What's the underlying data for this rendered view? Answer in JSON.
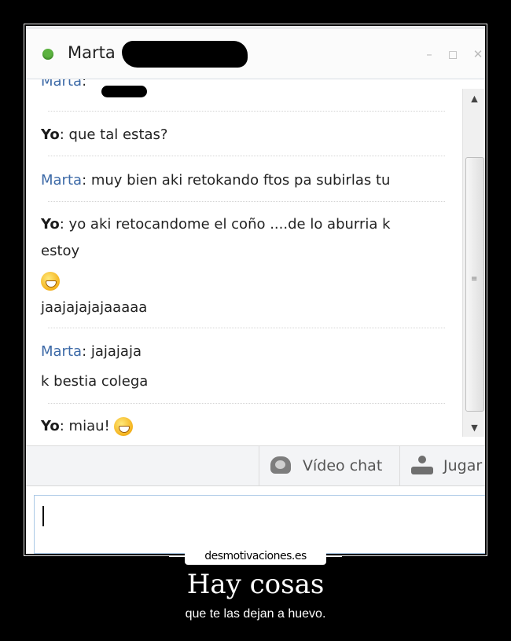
{
  "window": {
    "contact_name": "Marta",
    "controls": {
      "minimize": "–",
      "maximize": "◻",
      "close": "✕"
    }
  },
  "messages": [
    {
      "sender": "Marta",
      "sep": ": ",
      "text": ""
    },
    {
      "sender": "Yo",
      "sep": ": ",
      "text": "que tal estas?"
    },
    {
      "sender": "Marta",
      "sep": ": ",
      "text": "muy bien aki retokando ftos pa subirlas tu"
    },
    {
      "sender": "Yo",
      "sep": ": ",
      "text": "yo aki retocandome el coño ....de lo aburria k",
      "line2": "estoy",
      "line3": "jaajajajajaaaaa"
    },
    {
      "sender": "Marta",
      "sep": ": ",
      "text": "jajajaja",
      "line2": "k bestia colega"
    },
    {
      "sender": "Yo",
      "sep": ": ",
      "text": "miau!"
    }
  ],
  "toolbar": {
    "video_chat_label": "Vídeo chat",
    "games_label": "Jugar"
  },
  "scrollbar": {
    "up": "▲",
    "down": "▼",
    "grip": "≡"
  },
  "poster": {
    "watermark": "desmotivaciones.es",
    "title": "Hay cosas",
    "subtitle": "que te las dejan a huevo."
  }
}
